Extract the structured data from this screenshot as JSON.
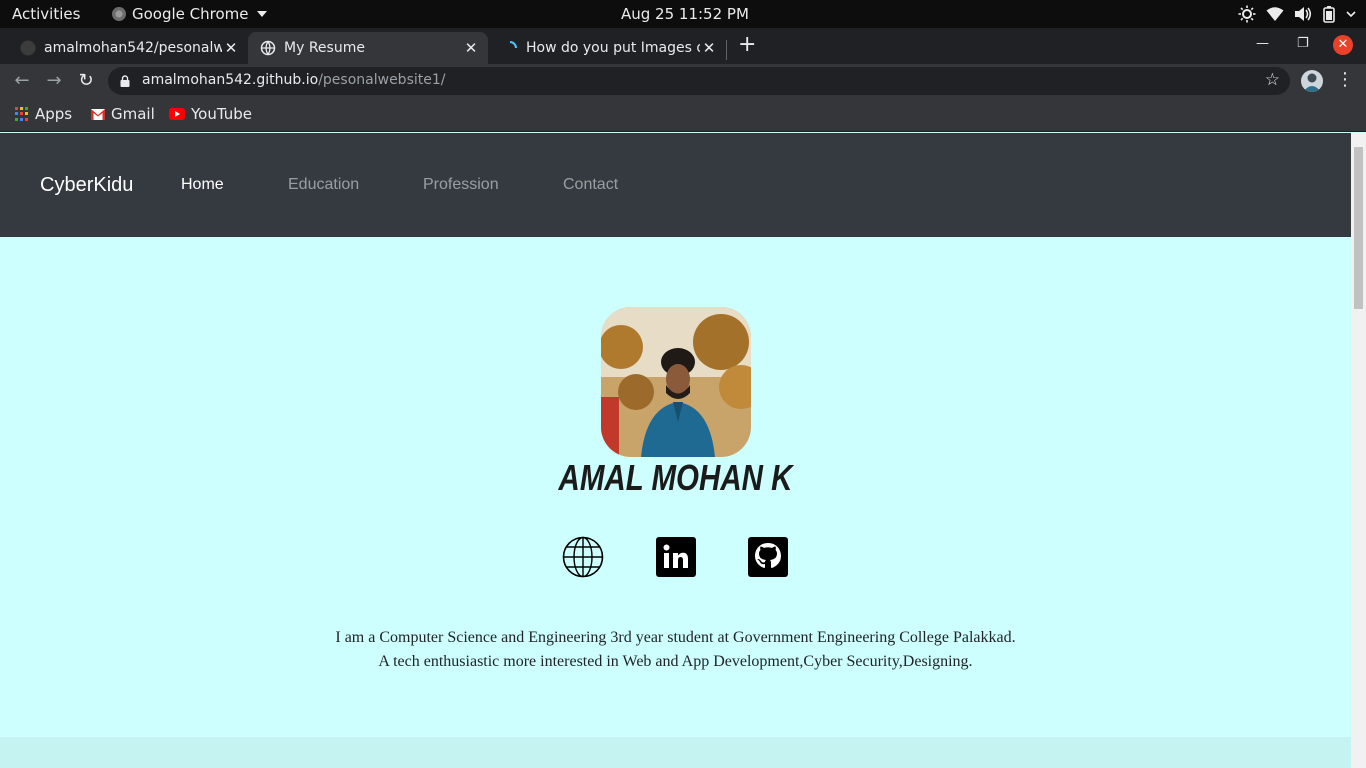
{
  "system_bar": {
    "activities": "Activities",
    "app_name": "Google Chrome",
    "clock": "Aug 25  11:52 PM"
  },
  "tabs": [
    {
      "title": "amalmohan542/pesonalw",
      "active": false
    },
    {
      "title": "My Resume",
      "active": true
    },
    {
      "title": "How do you put Images o",
      "active": false
    }
  ],
  "address_bar": {
    "domain": "amalmohan542.github.io",
    "path": "/pesonalwebsite1/"
  },
  "bookmarks": [
    {
      "label": "Apps",
      "icon": "apps-grid-icon"
    },
    {
      "label": "Gmail",
      "icon": "gmail-icon"
    },
    {
      "label": "YouTube",
      "icon": "youtube-icon"
    }
  ],
  "site": {
    "brand": "CyberKidu",
    "nav": [
      {
        "label": "Home",
        "active": true
      },
      {
        "label": "Education",
        "active": false
      },
      {
        "label": "Profession",
        "active": false
      },
      {
        "label": "Contact",
        "active": false
      }
    ],
    "name": "AMAL MOHAN K",
    "social_icons": [
      "globe-icon",
      "linkedin-icon",
      "github-icon"
    ],
    "bio_line1": "I am a Computer Science and Engineering 3rd year student at Government Engineering College Palakkad.",
    "bio_line2": "A tech enthusiastic more interested in Web and App Development,Cyber Security,Designing."
  },
  "colors": {
    "page_background": "#ccfffd",
    "navbar": "#343a40",
    "close_button": "#e9412a"
  }
}
